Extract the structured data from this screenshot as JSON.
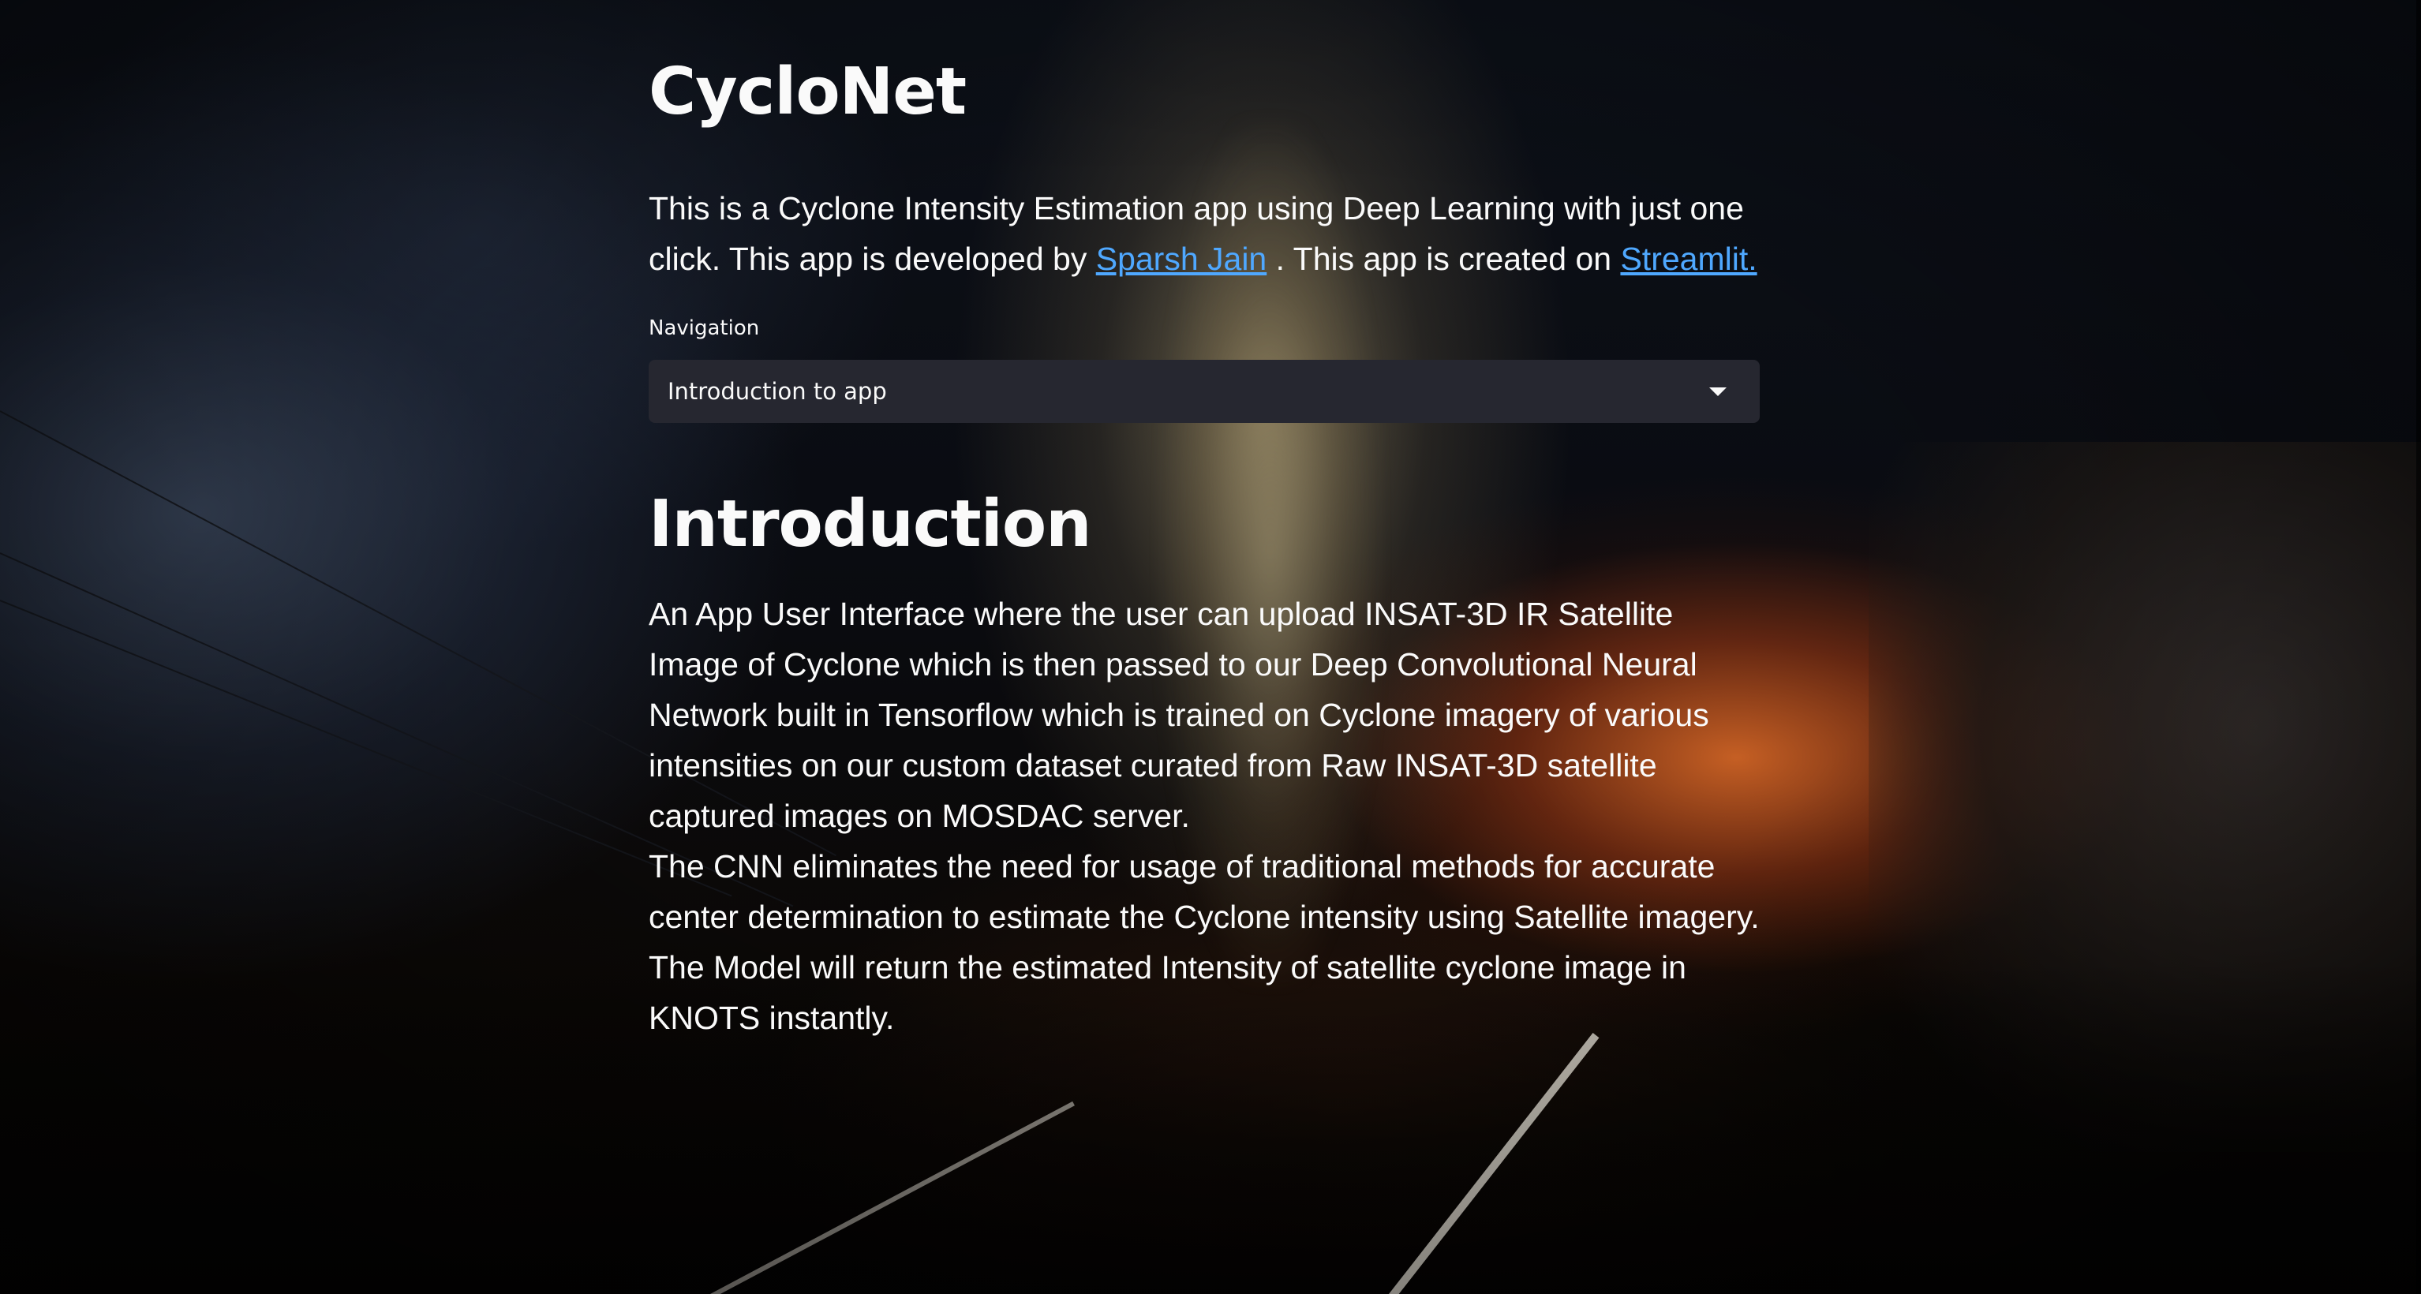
{
  "app": {
    "title": "CycloNet"
  },
  "intro": {
    "text_1": "This is a Cyclone Intensity Estimation app using Deep Learning with just one click. This app is developed by ",
    "author_link": "Sparsh Jain",
    "text_2": " . This app is created on ",
    "platform_link": "Streamlit."
  },
  "navigation": {
    "label": "Navigation",
    "selected": "Introduction to app",
    "icon": "chevron-down-icon"
  },
  "section": {
    "heading": "Introduction",
    "paragraph_1": "An App User Interface where the user can upload INSAT-3D IR Satellite Image of Cyclone which is then passed to our Deep Convolutional Neural Network built in Tensorflow which is trained on Cyclone imagery of various intensities on our custom dataset curated from Raw INSAT-3D satellite captured images on MOSDAC server.",
    "paragraph_2": "The CNN eliminates the need for usage of traditional methods for accurate center determination to estimate the Cyclone intensity using Satellite imagery.",
    "paragraph_3": "The Model will return the estimated Intensity of satellite cyclone image in KNOTS instantly."
  },
  "colors": {
    "text": "#fafafa",
    "link": "#4fa8ff",
    "select_background": "#262730"
  }
}
